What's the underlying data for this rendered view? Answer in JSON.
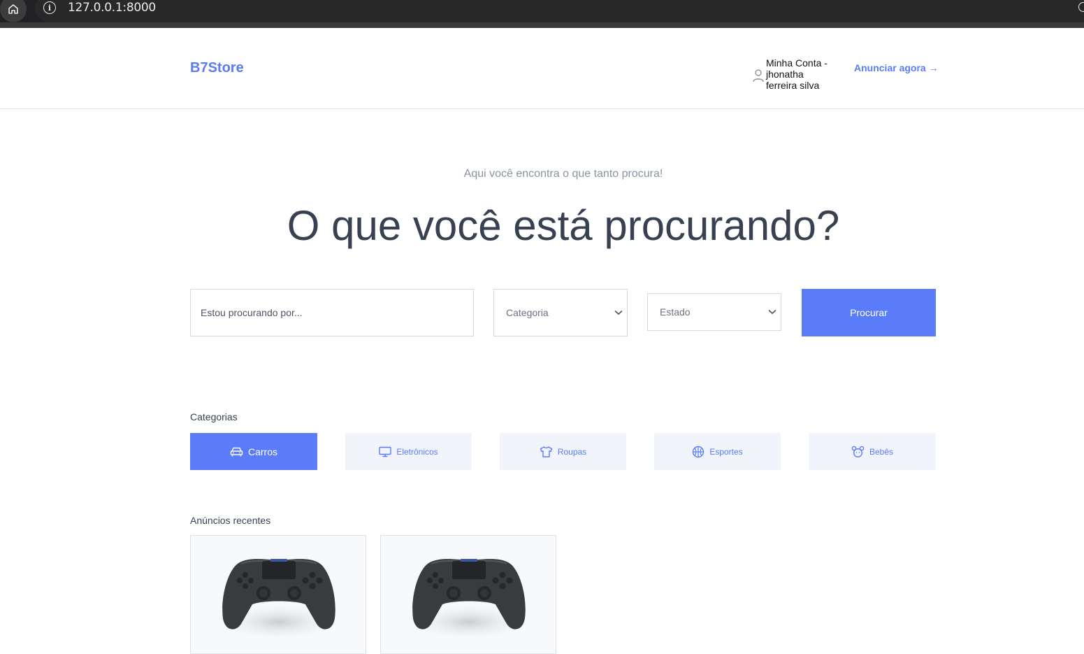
{
  "browser": {
    "url": "127.0.0.1:8000",
    "home_icon": "home-icon",
    "info_icon": "info-icon"
  },
  "header": {
    "logo": "B7Store",
    "account_label": "Minha Conta - jhonatha ferreira silva",
    "account_icon": "user-icon",
    "announce_label": "Anunciar agora →"
  },
  "hero": {
    "tagline": "Aqui você encontra o que tanto procura!",
    "headline": "O que você está procurando?"
  },
  "search": {
    "placeholder": "Estou procurando por...",
    "category_select": "Categoria",
    "state_select": "Estado",
    "button_label": "Procurar"
  },
  "categories": {
    "title": "Categorias",
    "items": [
      {
        "label": "Carros",
        "icon": "car-icon",
        "active": true
      },
      {
        "label": "Eletrônicos",
        "icon": "monitor-icon",
        "active": false
      },
      {
        "label": "Roupas",
        "icon": "shirt-icon",
        "active": false
      },
      {
        "label": "Esportes",
        "icon": "basketball-icon",
        "active": false
      },
      {
        "label": "Bebês",
        "icon": "baby-icon",
        "active": false
      }
    ]
  },
  "recent_ads": {
    "title": "Anúncios recentes",
    "items": [
      {
        "image": "game-controller-image"
      },
      {
        "image": "game-controller-image"
      }
    ]
  },
  "colors": {
    "accent": "#5a7cf8",
    "text_dark": "#374151",
    "muted": "#8a939f",
    "category_bg": "#f1f4fb"
  }
}
